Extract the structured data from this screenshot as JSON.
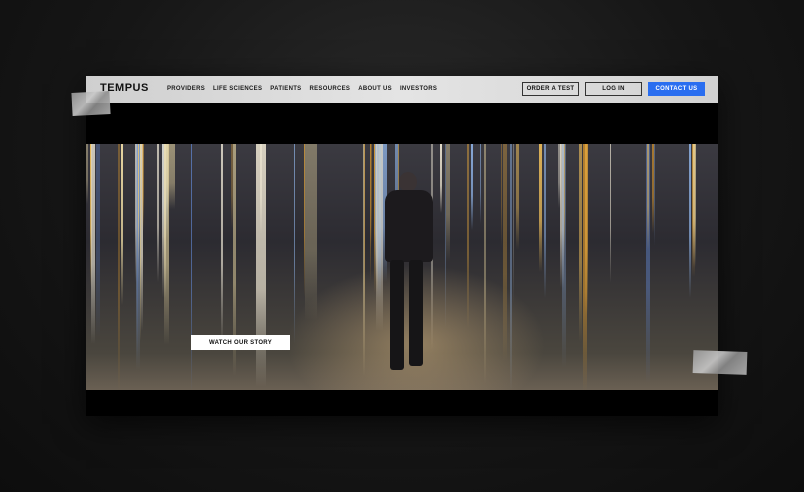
{
  "header": {
    "logo": "TEMPUS",
    "nav": [
      {
        "label": "PROVIDERS"
      },
      {
        "label": "LIFE SCIENCES"
      },
      {
        "label": "PATIENTS"
      },
      {
        "label": "RESOURCES"
      },
      {
        "label": "ABOUT US"
      },
      {
        "label": "INVESTORS"
      }
    ],
    "order_label": "ORDER A TEST",
    "login_label": "LOG IN",
    "contact_label": "CONTACT US"
  },
  "hero": {
    "cta_label": "WATCH OUR STORY"
  },
  "colors": {
    "accent": "#2a6ef0",
    "background": "#161616",
    "header": "#dcdcdc"
  }
}
